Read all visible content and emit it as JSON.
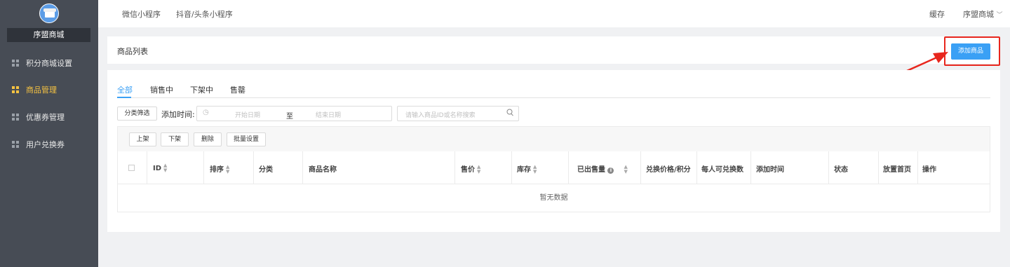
{
  "sidebar": {
    "shop_name": "序盟商城",
    "items": [
      {
        "label": "积分商城设置"
      },
      {
        "label": "商品管理"
      },
      {
        "label": "优惠券管理"
      },
      {
        "label": "用户兑换券"
      }
    ]
  },
  "topbar": {
    "tabs": [
      {
        "label": "微信小程序"
      },
      {
        "label": "抖音/头条小程序"
      }
    ],
    "cache": "缓存",
    "user": "序盟商城"
  },
  "panel": {
    "title": "商品列表",
    "add_button": "添加商品"
  },
  "tabs": [
    {
      "label": "全部"
    },
    {
      "label": "销售中"
    },
    {
      "label": "下架中"
    },
    {
      "label": "售罄"
    }
  ],
  "filters": {
    "category_button": "分类筛选",
    "date_label": "添加时间:",
    "start_placeholder": "开始日期",
    "separator": "至",
    "end_placeholder": "结束日期",
    "search_placeholder": "请输入商品ID或名称搜索"
  },
  "batch": {
    "on": "上架",
    "off": "下架",
    "delete": "删除",
    "settings": "批量设置"
  },
  "table": {
    "columns": [
      {
        "label": "ID"
      },
      {
        "label": "排序"
      },
      {
        "label": "分类"
      },
      {
        "label": "商品名称"
      },
      {
        "label": "售价"
      },
      {
        "label": "库存"
      },
      {
        "label": "已出售量"
      },
      {
        "label": "兑换价格/积分"
      },
      {
        "label": "每人可兑换数"
      },
      {
        "label": "添加时间"
      },
      {
        "label": "状态"
      },
      {
        "label": "放置首页"
      },
      {
        "label": "操作"
      }
    ],
    "empty_text": "暂无数据"
  },
  "colors": {
    "accent": "#3aa0f5",
    "sidebar": "#474c55",
    "active_menu": "#f5c242",
    "highlight": "#e8261d"
  }
}
